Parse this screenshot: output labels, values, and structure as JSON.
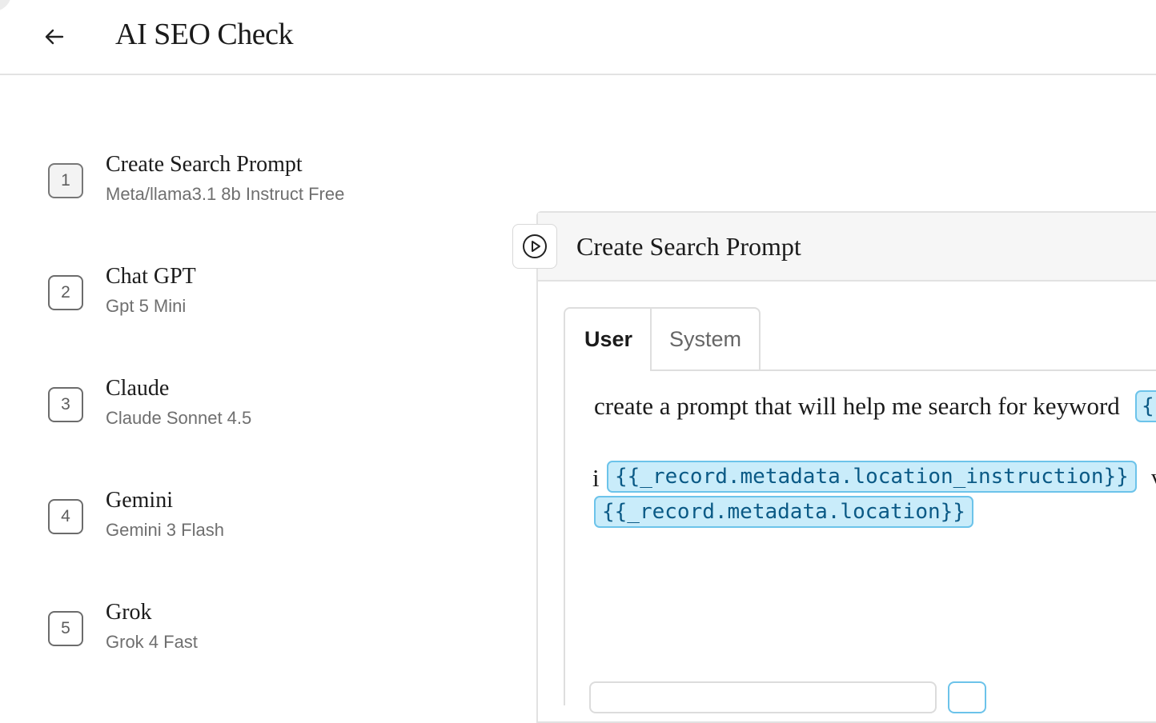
{
  "header": {
    "title": "AI SEO Check",
    "back_icon": "arrow-left-icon"
  },
  "steps": [
    {
      "number": "1",
      "name": "Create Search Prompt",
      "model": "Meta/llama3.1 8b Instruct Free",
      "active": true
    },
    {
      "number": "2",
      "name": "Chat GPT",
      "model": "Gpt 5 Mini",
      "active": false
    },
    {
      "number": "3",
      "name": "Claude",
      "model": "Claude Sonnet 4.5",
      "active": false
    },
    {
      "number": "4",
      "name": "Gemini",
      "model": "Gemini 3 Flash",
      "active": false
    },
    {
      "number": "5",
      "name": "Grok",
      "model": "Grok 4 Fast",
      "active": false
    }
  ],
  "panel": {
    "title": "Create Search Prompt",
    "run_icon": "play-circle-icon",
    "tabs": [
      {
        "label": "User",
        "selected": true
      },
      {
        "label": "System",
        "selected": false
      }
    ],
    "editor": {
      "line1_text": "create a prompt that will help me search for keyword",
      "line1_chip": "{",
      "line2_prefix": "i",
      "line2_chip": "{{_record.metadata.location_instruction}}",
      "line2_trailing": "v",
      "line3_chip": "{{_record.metadata.location}}"
    }
  },
  "colors": {
    "chip_bg": "#c9ecfa",
    "chip_border": "#6cc3ea",
    "chip_text": "#0b5a86",
    "panel_header_bg": "#f6f6f6"
  }
}
